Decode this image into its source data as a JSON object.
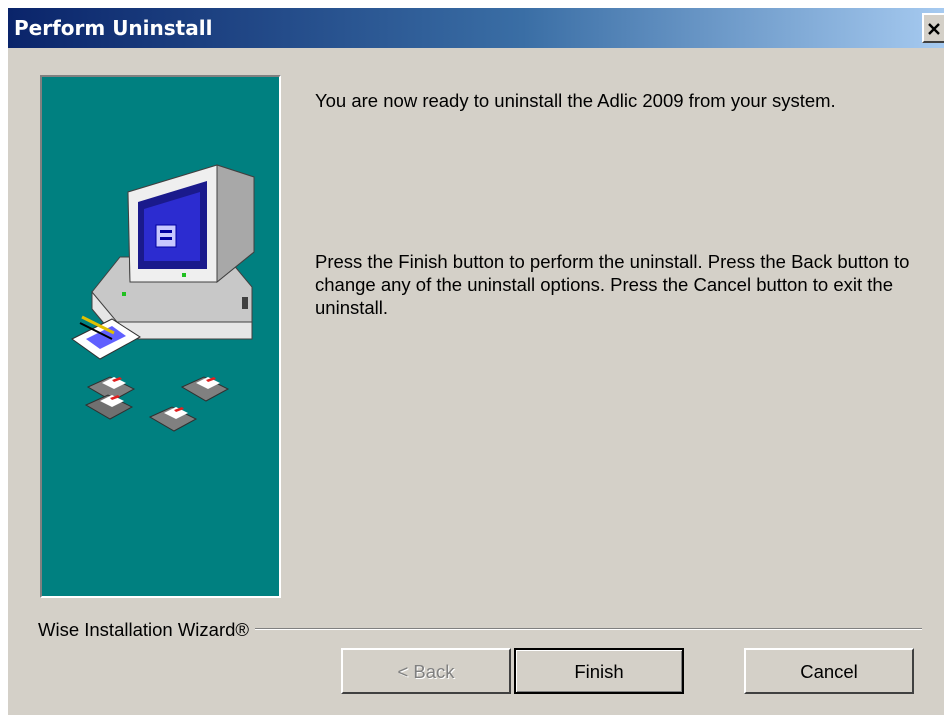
{
  "window": {
    "title": "Perform Uninstall",
    "close_icon": "close-icon"
  },
  "content": {
    "ready_text": "You are now ready to uninstall the Adlic 2009 from your system.",
    "instructions_text": "Press the Finish button to perform the uninstall. Press the Back button to change any of the uninstall options. Press the Cancel button to exit the uninstall."
  },
  "footer": {
    "group_label": "Wise Installation Wizard®",
    "back_label": "< Back",
    "back_enabled": false,
    "finish_label": "Finish",
    "cancel_label": "Cancel"
  },
  "illustration": {
    "background_color": "#008080",
    "icons": [
      "computer-icon",
      "notepad-icon",
      "floppy-disks-icon"
    ]
  }
}
